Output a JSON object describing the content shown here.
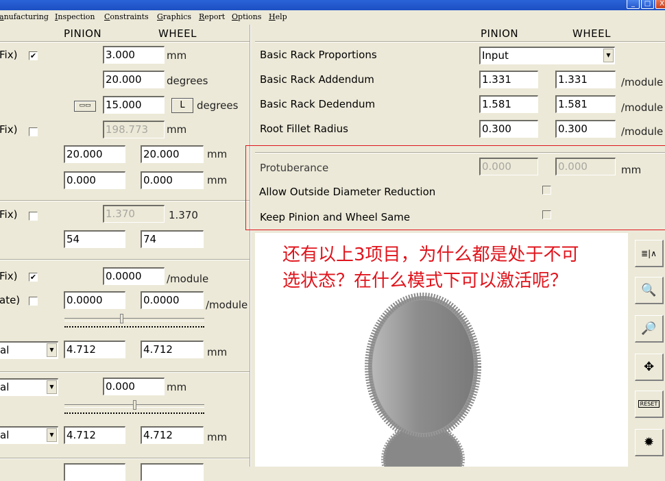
{
  "window": {
    "minimize": "_",
    "maximize": "□",
    "close": "X"
  },
  "menu": [
    "anufacturing",
    "Inspection",
    "Constraints",
    "Graphics",
    "Report",
    "Options",
    "Help"
  ],
  "left": {
    "headers": {
      "pinion": "PINION",
      "wheel": "WHEEL"
    },
    "row1": {
      "label": "Fix)",
      "checked": "✔",
      "value": "3.000",
      "unit": "mm"
    },
    "row2": {
      "value": "20.000",
      "unit": "degrees"
    },
    "row3": {
      "btn_l": "L",
      "value": "15.000",
      "unit": "degrees"
    },
    "row4": {
      "label": "Fix)",
      "value": "198.773",
      "unit": "mm"
    },
    "row5": {
      "pinion": "20.000",
      "wheel": "20.000",
      "unit": "mm"
    },
    "row6": {
      "pinion": "0.000",
      "wheel": "0.000",
      "unit": "mm"
    },
    "row7": {
      "label": "Fix)",
      "value": "1.370",
      "text": "1.370"
    },
    "row8": {
      "pinion": "54",
      "wheel": "74"
    },
    "row9": {
      "label": "Fix)",
      "checked": "✔",
      "value": "0.0000",
      "unit": "/module"
    },
    "row10": {
      "label": "ate)",
      "pinion": "0.0000",
      "wheel": "0.0000",
      "unit": "/module"
    },
    "row11": {
      "combo": "al",
      "pinion": "4.712",
      "wheel": "4.712",
      "unit": "mm"
    },
    "row12": {
      "combo": "al",
      "value": "0.000",
      "unit": "mm"
    },
    "row13": {
      "combo": "al",
      "pinion": "4.712",
      "wheel": "4.712",
      "unit": "mm"
    }
  },
  "right": {
    "headers": {
      "pinion": "PINION",
      "wheel": "WHEEL"
    },
    "basic_rack_proportions": {
      "label": "Basic Rack Proportions",
      "value": "Input"
    },
    "basic_rack_addendum": {
      "label": "Basic Rack Addendum",
      "pinion": "1.331",
      "wheel": "1.331",
      "unit": "/module"
    },
    "basic_rack_dedendum": {
      "label": "Basic Rack Dedendum",
      "pinion": "1.581",
      "wheel": "1.581",
      "unit": "/module"
    },
    "root_fillet_radius": {
      "label": "Root Fillet Radius",
      "pinion": "0.300",
      "wheel": "0.300",
      "unit": "/module"
    },
    "protuberance": {
      "label": "Protuberance",
      "pinion": "0.000",
      "wheel": "0.000",
      "unit": "mm"
    },
    "allow_od_reduction": {
      "label": "Allow Outside Diameter Reduction"
    },
    "keep_same": {
      "label": "Keep Pinion and Wheel Same"
    }
  },
  "annotation": {
    "line1": "还有以上3项目，为什么都是处于不可",
    "line2": "选状态？在什么模式下可以激活呢？",
    "color": "#e0141c"
  },
  "toolbar": {
    "reset": "RESET"
  }
}
